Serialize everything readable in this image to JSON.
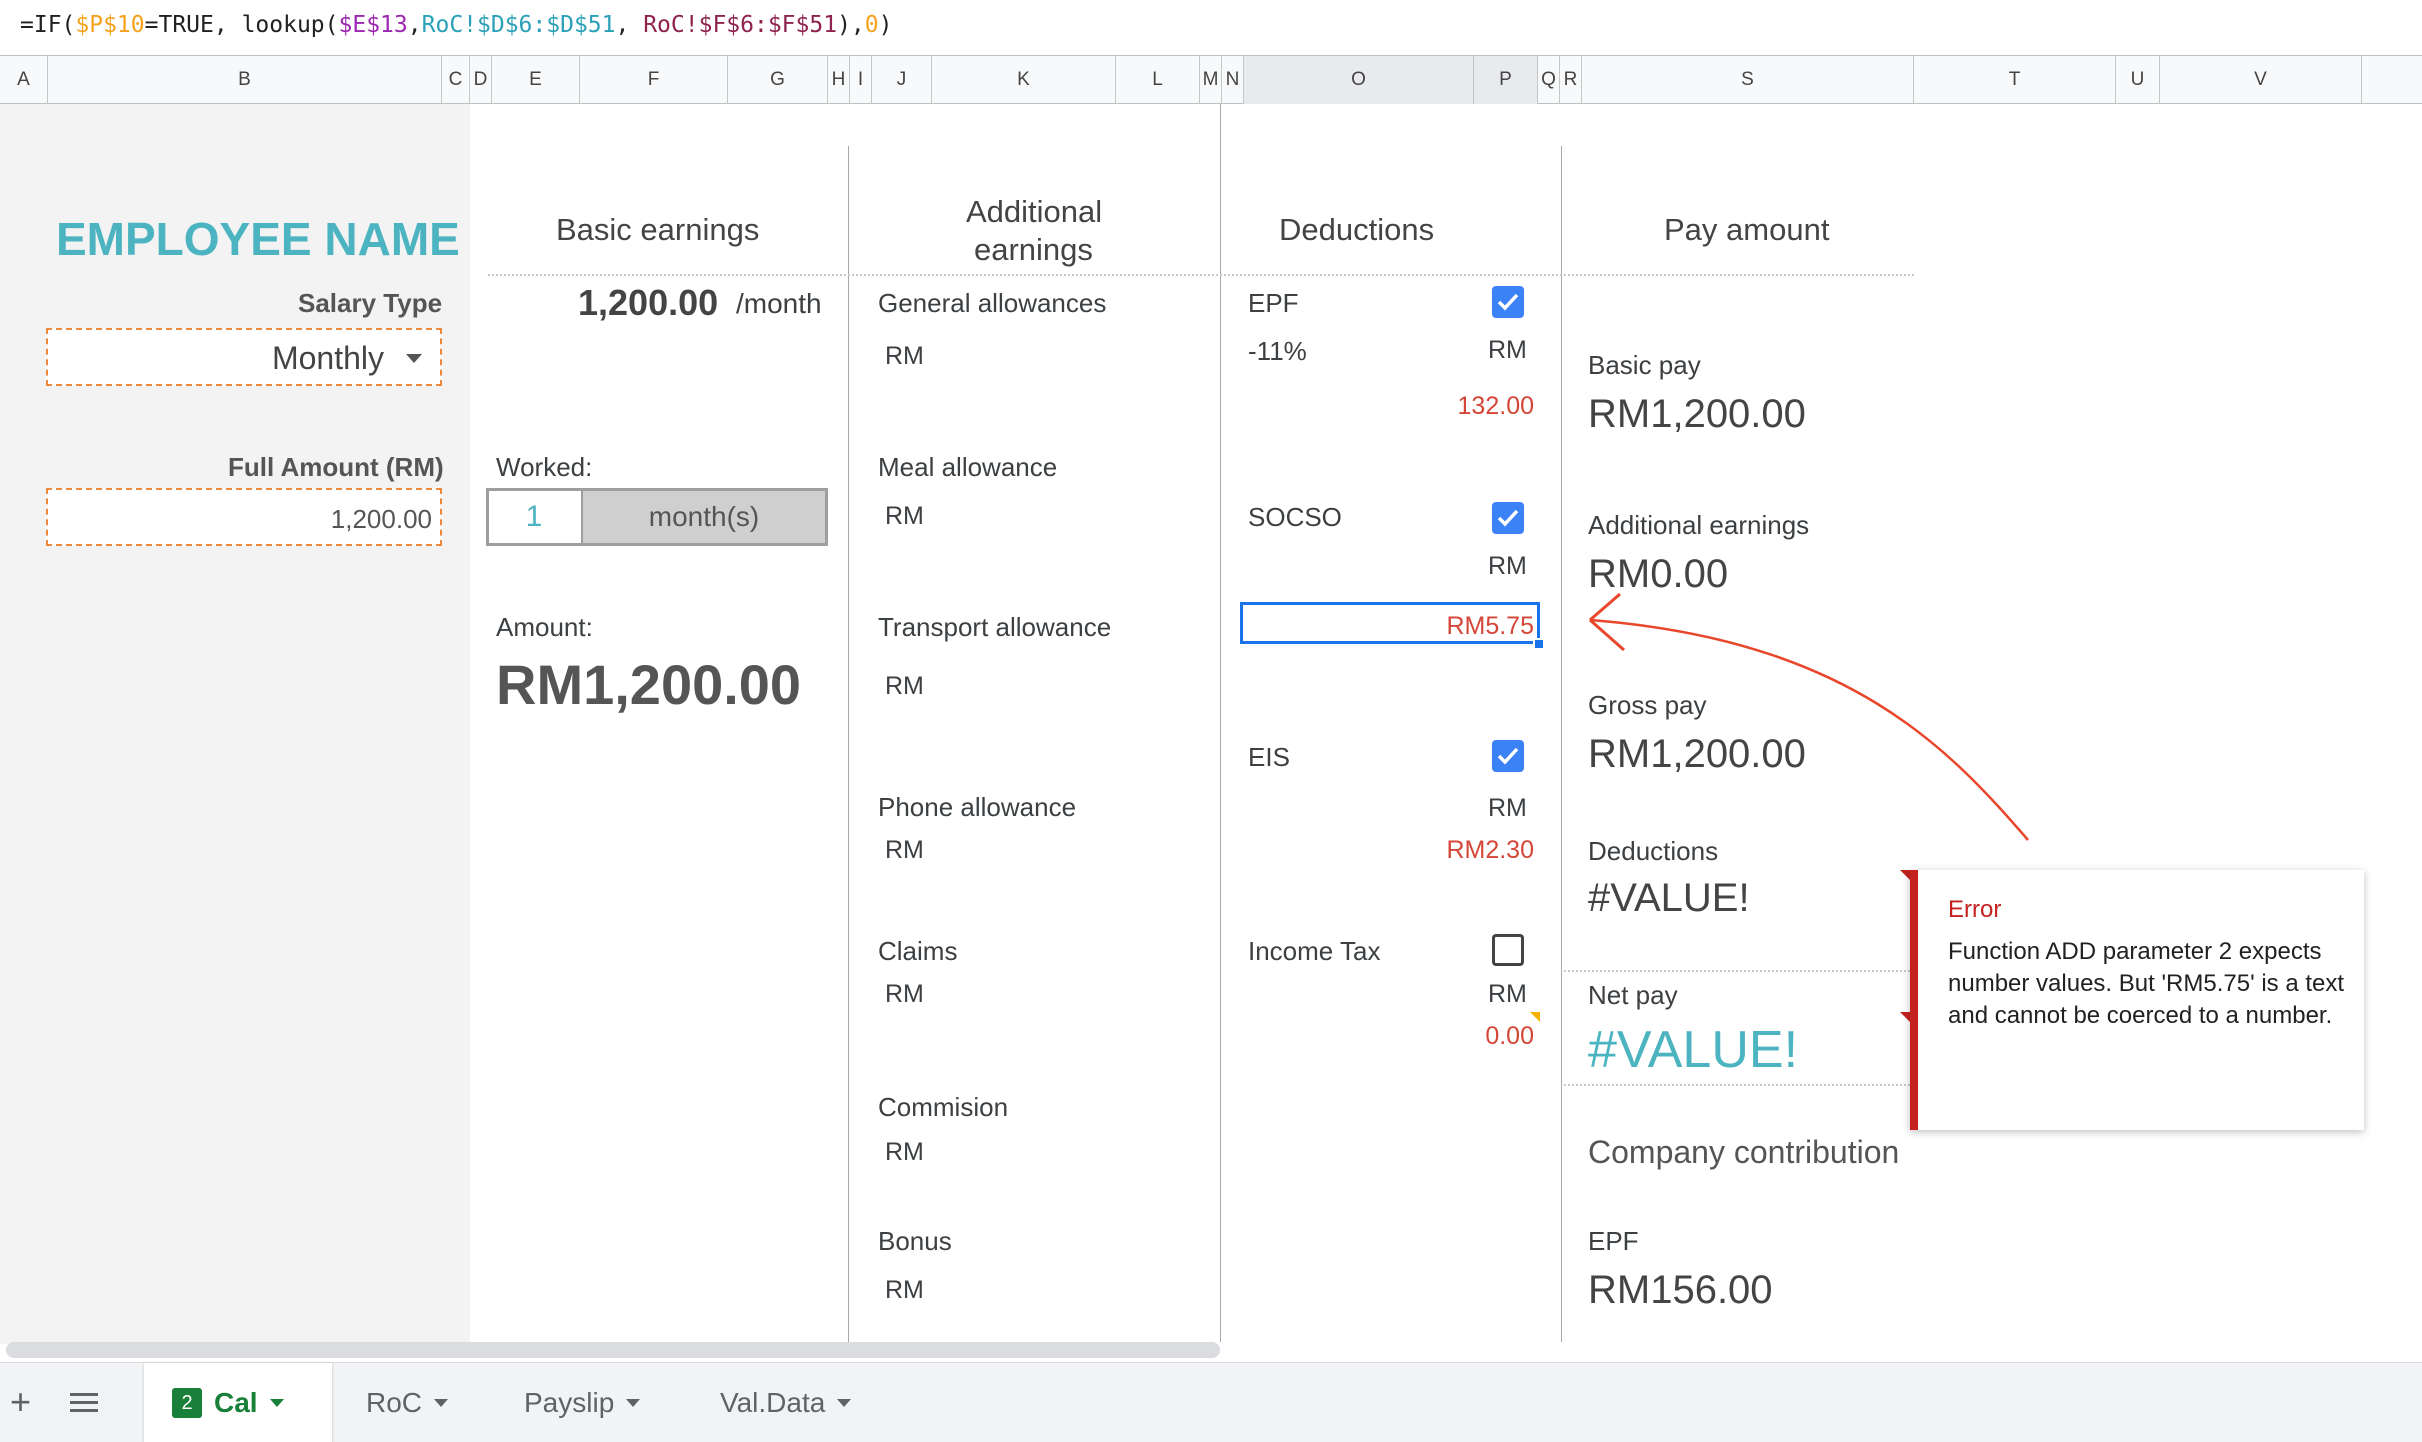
{
  "formula": {
    "p1": "=IF(",
    "p2": "$P$10",
    "p3": "=TRUE, lookup(",
    "p4": "$E$13",
    "p5": ",",
    "p6": "RoC!$D$6:$D$51",
    "p7": ", ",
    "p8": "RoC!$F$6:$F$51",
    "p9": "),",
    "p10": "0",
    "p11": ")"
  },
  "columns": [
    "A",
    "B",
    "C",
    "D",
    "E",
    "F",
    "G",
    "H",
    "I",
    "J",
    "K",
    "L",
    "M",
    "N",
    "O",
    "P",
    "Q",
    "R",
    "S",
    "T",
    "U",
    "V"
  ],
  "employee": {
    "name": "EMPLOYEE NAME",
    "salary_type_label": "Salary Type",
    "salary_type_value": "Monthly",
    "full_amount_label": "Full Amount (RM)",
    "full_amount_value": "1,200.00"
  },
  "basic": {
    "header": "Basic earnings",
    "rate": "1,200.00",
    "rate_unit": "/month",
    "worked_label": "Worked:",
    "worked_value": "1",
    "worked_unit": "month(s)",
    "amount_label": "Amount:",
    "amount_value": "RM1,200.00"
  },
  "additional": {
    "header_line1": "Additional",
    "header_line2": "earnings",
    "currency": "RM",
    "items": [
      "General allowances",
      "Meal allowance",
      "Transport allowance",
      "Phone allowance",
      "Claims",
      "Commision",
      "Bonus"
    ]
  },
  "deductions": {
    "header": "Deductions",
    "currency": "RM",
    "epf_label": "EPF",
    "epf_rate": "-11%",
    "epf_value": "132.00",
    "socso_label": "SOCSO",
    "socso_value": "RM5.75",
    "eis_label": "EIS",
    "eis_value": "RM2.30",
    "income_tax_label": "Income Tax",
    "income_tax_value": "0.00"
  },
  "pay": {
    "header": "Pay amount",
    "basic_pay_label": "Basic pay",
    "basic_pay_value": "RM1,200.00",
    "additional_label": "Additional earnings",
    "additional_value": "RM0.00",
    "gross_label": "Gross pay",
    "gross_value": "RM1,200.00",
    "deductions_label": "Deductions",
    "deductions_value": "#VALUE!",
    "net_label": "Net pay",
    "net_value": "#VALUE!",
    "company_label": "Company contribution",
    "company_epf_label": "EPF",
    "company_epf_value": "RM156.00"
  },
  "error": {
    "title": "Error",
    "message": "Function ADD parameter 2 expects number values. But 'RM5.75' is a text and cannot be coerced to a number."
  },
  "tabs": {
    "add_icon": "plus-icon",
    "list_icon": "menu-icon",
    "badge": "2",
    "items": [
      "Cal",
      "RoC",
      "Payslip",
      "Val.Data"
    ]
  },
  "colors": {
    "accent": "#4cb3c1",
    "error": "#c5221f",
    "negative": "#d44638",
    "checkbox": "#3b82f6",
    "selection": "#1a73e8"
  }
}
